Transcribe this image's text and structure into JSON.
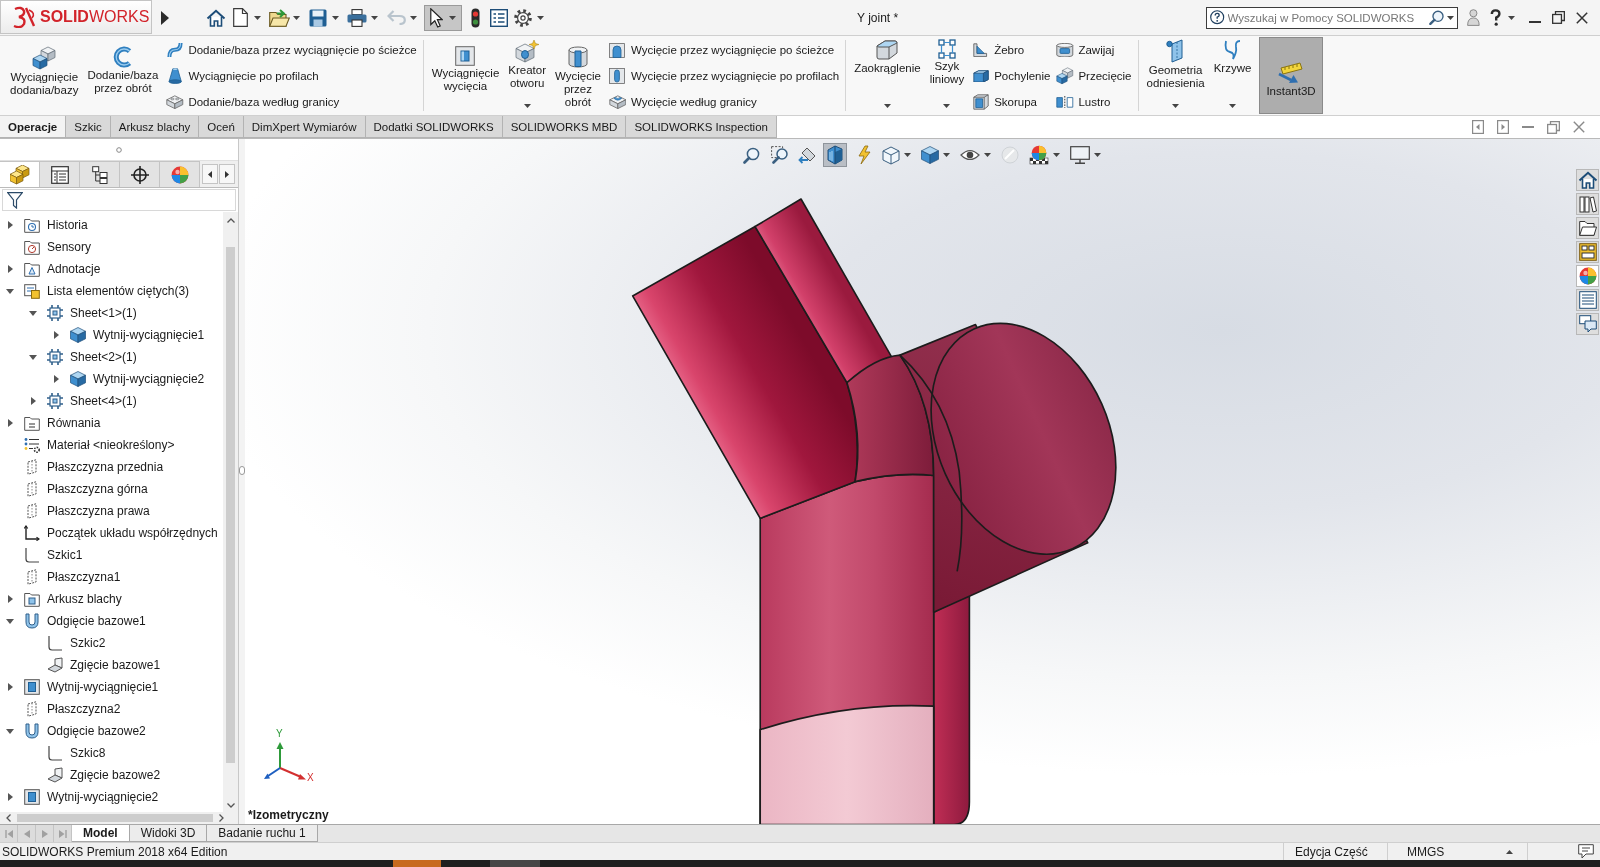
{
  "title_bar": {
    "app_name": "**SOLID**WORKS",
    "document_title": "Y joint *",
    "search": {
      "placeholder": "Wyszukaj w Pomocy SOLIDWORKS"
    }
  },
  "quick_access": {
    "undo": {
      "disabled": true
    },
    "select": {
      "selected": true
    }
  },
  "ribbon": {
    "groups": [
      {
        "items": [
          {
            "kind": "large",
            "label": "Wyciągnięcie\ndodania/bazy",
            "dropdown": false
          },
          {
            "kind": "large",
            "label": "Dodanie/baza\nprzez obrót",
            "dropdown": false
          },
          {
            "kind": "small",
            "label": "Dodanie/baza przez wyciągnięcie po ścieżce"
          },
          {
            "kind": "small",
            "label": "Wyciągnięcie po profilach"
          },
          {
            "kind": "small",
            "label": "Dodanie/baza według granicy"
          }
        ]
      },
      {
        "items": [
          {
            "kind": "large",
            "label": "Wyciągnięcie\nwycięcia",
            "dropdown": false
          },
          {
            "kind": "large",
            "label": "Kreator\notworu",
            "dropdown": true
          },
          {
            "kind": "large",
            "label": "Wycięcie\nprzez\nobrót",
            "dropdown": false
          },
          {
            "kind": "small",
            "label": "Wycięcie przez wyciągnięcie po ścieżce"
          },
          {
            "kind": "small",
            "label": "Wycięcie przez wyciągnięcie po profilach"
          },
          {
            "kind": "small",
            "label": "Wycięcie według granicy"
          }
        ]
      },
      {
        "items": [
          {
            "kind": "large",
            "label": "Zaokrąglenie",
            "dropdown": true
          },
          {
            "kind": "large",
            "label": "Szyk\nliniowy",
            "dropdown": true
          },
          {
            "kind": "small",
            "label": "Żebro"
          },
          {
            "kind": "small",
            "label": "Pochylenie"
          },
          {
            "kind": "small",
            "label": "Skorupa"
          },
          {
            "kind": "small",
            "label": "Zawijaj"
          },
          {
            "kind": "small",
            "label": "Przecięcie"
          },
          {
            "kind": "small",
            "label": "Lustro"
          }
        ]
      },
      {
        "items": [
          {
            "kind": "large",
            "label": "Geometria\nodniesienia",
            "dropdown": true,
            "on": false
          },
          {
            "kind": "large",
            "label": "Krzywe",
            "dropdown": true,
            "on": false
          },
          {
            "kind": "large",
            "label": "Instant3D",
            "dropdown": false,
            "on": true
          }
        ]
      }
    ]
  },
  "command_tabs": [
    {
      "label": "Operacje",
      "selected": true
    },
    {
      "label": "Szkic",
      "selected": false
    },
    {
      "label": "Arkusz blachy",
      "selected": false
    },
    {
      "label": "Oceń",
      "selected": false
    },
    {
      "label": "DimXpert Wymiarów",
      "selected": false
    },
    {
      "label": "Dodatki SOLIDWORKS",
      "selected": false
    },
    {
      "label": "SOLIDWORKS MBD",
      "selected": false
    },
    {
      "label": "SOLIDWORKS Inspection",
      "selected": false
    }
  ],
  "feature_manager": {
    "panel_tabs": [
      {
        "selected": true
      },
      {
        "selected": false
      },
      {
        "selected": false
      },
      {
        "selected": false
      },
      {
        "selected": false
      }
    ],
    "tree": [
      {
        "label": "Historia",
        "kind": "history",
        "expanded": false
      },
      {
        "label": "Sensory",
        "kind": "sensors"
      },
      {
        "label": "Adnotacje",
        "kind": "annotations",
        "expanded": false
      },
      {
        "label": "Lista elementów ciętych(3)",
        "kind": "cutlist",
        "expanded": true,
        "children": [
          {
            "label": "Sheet<1>(1)",
            "kind": "sheet",
            "expanded": true,
            "children": [
              {
                "label": "Wytnij-wyciągnięcie1",
                "kind": "body",
                "expanded": false
              }
            ]
          },
          {
            "label": "Sheet<2>(1)",
            "kind": "sheet",
            "expanded": true,
            "children": [
              {
                "label": "Wytnij-wyciągnięcie2",
                "kind": "body",
                "expanded": false
              }
            ]
          },
          {
            "label": "Sheet<4>(1)",
            "kind": "sheet",
            "expanded": false
          }
        ]
      },
      {
        "label": "Równania",
        "kind": "equations",
        "expanded": false
      },
      {
        "label": "Materiał <nieokreślony>",
        "kind": "material"
      },
      {
        "label": "Płaszczyzna przednia",
        "kind": "plane"
      },
      {
        "label": "Płaszczyzna górna",
        "kind": "plane"
      },
      {
        "label": "Płaszczyzna prawa",
        "kind": "plane"
      },
      {
        "label": "Początek układu współrzędnych",
        "kind": "origin"
      },
      {
        "label": "Szkic1",
        "kind": "sketch"
      },
      {
        "label": "Płaszczyzna1",
        "kind": "plane"
      },
      {
        "label": "Arkusz blachy",
        "kind": "sheetmetal",
        "expanded": false
      },
      {
        "label": "Odgięcie bazowe1",
        "kind": "flange",
        "expanded": true,
        "children": [
          {
            "label": "Szkic2",
            "kind": "sketch"
          },
          {
            "label": "Zgięcie bazowe1",
            "kind": "bend"
          }
        ]
      },
      {
        "label": "Wytnij-wyciągnięcie1",
        "kind": "cut",
        "expanded": false
      },
      {
        "label": "Płaszczyzna2",
        "kind": "plane"
      },
      {
        "label": "Odgięcie bazowe2",
        "kind": "flange",
        "expanded": true,
        "children": [
          {
            "label": "Szkic8",
            "kind": "sketch"
          },
          {
            "label": "Zgięcie bazowe2",
            "kind": "bend"
          }
        ]
      },
      {
        "label": "Wytnij-wyciągnięcie2",
        "kind": "cut",
        "expanded": false
      }
    ]
  },
  "viewport": {
    "view_toolbar": [
      {
        "selected": false,
        "dropdown": false
      },
      {
        "selected": false,
        "dropdown": false
      },
      {
        "selected": false,
        "dropdown": false
      },
      {
        "selected": true,
        "dropdown": false
      },
      {
        "selected": false,
        "dropdown": false
      },
      {
        "selected": false,
        "dropdown": true
      },
      {
        "selected": false,
        "dropdown": true
      },
      {
        "selected": false,
        "dropdown": true
      },
      {
        "selected": false,
        "dropdown": false
      },
      {
        "selected": false,
        "dropdown": true
      },
      {
        "selected": false,
        "dropdown": true
      }
    ],
    "task_pane": [
      {
        "selected": false
      },
      {
        "selected": false
      },
      {
        "selected": false
      },
      {
        "selected": false
      },
      {
        "selected": true
      },
      {
        "selected": false
      },
      {
        "selected": false
      }
    ],
    "view_name": "*Izometryczny",
    "triad_labels": [
      "Y",
      "X"
    ]
  },
  "document_tabs": [
    {
      "label": "Model",
      "selected": true
    },
    {
      "label": "Widoki 3D",
      "selected": false
    },
    {
      "label": "Badanie ruchu 1",
      "selected": false
    }
  ],
  "status_bar": {
    "product": "SOLIDWORKS Premium 2018 x64 Edition",
    "mode": "Edycja Część",
    "units": "MMGS"
  }
}
